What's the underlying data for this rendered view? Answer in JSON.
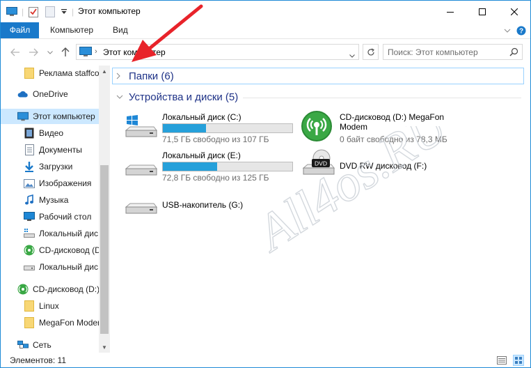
{
  "window": {
    "title": "Этот компьютер",
    "accent": "#1979ca"
  },
  "ribbon": {
    "tabs": [
      {
        "label": "Файл",
        "active": true
      },
      {
        "label": "Компьютер",
        "active": false
      },
      {
        "label": "Вид",
        "active": false
      }
    ]
  },
  "address": {
    "path": "Этот компьютер",
    "search_placeholder": "Поиск: Этот компьютер"
  },
  "nav": {
    "items": [
      {
        "label": "Реклама staffco",
        "icon": "folder-icon"
      },
      {
        "label": "OneDrive",
        "icon": "onedrive-icon"
      },
      {
        "label": "Этот компьютер",
        "icon": "computer-icon",
        "selected": true
      },
      {
        "label": "Видео",
        "icon": "video-icon"
      },
      {
        "label": "Документы",
        "icon": "documents-icon"
      },
      {
        "label": "Загрузки",
        "icon": "downloads-icon"
      },
      {
        "label": "Изображения",
        "icon": "pictures-icon"
      },
      {
        "label": "Музыка",
        "icon": "music-icon"
      },
      {
        "label": "Рабочий стол",
        "icon": "desktop-icon"
      },
      {
        "label": "Локальный дис",
        "icon": "local-disk-icon"
      },
      {
        "label": "CD-дисковод (D",
        "icon": "megafon-icon"
      },
      {
        "label": "Локальный дис",
        "icon": "local-disk-icon"
      },
      {
        "label": "CD-дисковод (D:)",
        "icon": "megafon-icon"
      },
      {
        "label": "Linux",
        "icon": "folder-icon"
      },
      {
        "label": "MegaFon Moder",
        "icon": "folder-icon"
      },
      {
        "label": "Сеть",
        "icon": "network-icon"
      }
    ]
  },
  "content": {
    "folders_header": "Папки (6)",
    "devices_header": "Устройства и диски (5)",
    "drives": [
      {
        "name": "Локальный диск (C:)",
        "free": "71,5 ГБ свободно из 107 ГБ",
        "used_fraction": 0.332
      },
      {
        "name": "Локальный диск (E:)",
        "free": "72,8 ГБ свободно из 125 ГБ",
        "used_fraction": 0.418
      },
      {
        "name": "USB-накопитель (G:)"
      },
      {
        "name_line1": "CD-дисковод (D:) MegaFon",
        "name_line2": "Modem",
        "free": "0 байт свободно из 78,3 МБ"
      },
      {
        "name": "DVD RW дисковод (F:)",
        "badge": "DVD"
      }
    ]
  },
  "status": {
    "items_count": "Элементов: 11"
  },
  "watermark": "All4os.RU",
  "colors": {
    "selection": "#cce8ff",
    "progress": "#26a0da",
    "group_header": "#1e3287",
    "annotation_arrow": "#e8232a"
  }
}
